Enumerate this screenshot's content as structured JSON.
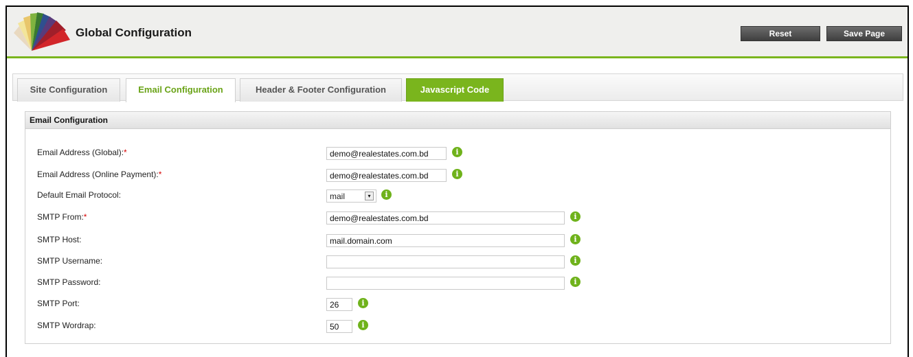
{
  "header": {
    "title": "Global Configuration",
    "reset_label": "Reset",
    "save_label": "Save Page",
    "accent_color": "#7ab51d"
  },
  "tabs": [
    {
      "label": "Site Configuration",
      "state": "normal"
    },
    {
      "label": "Email Configuration",
      "state": "active"
    },
    {
      "label": "Header & Footer Configuration",
      "state": "normal"
    },
    {
      "label": "Javascript Code",
      "state": "highlighted"
    }
  ],
  "panel": {
    "title": "Email Configuration",
    "fields": [
      {
        "label": "Email Address (Global):",
        "required": true,
        "value": "demo@realestates.com.bd",
        "type": "text"
      },
      {
        "label": "Email Address (Online Payment):",
        "required": true,
        "value": "demo@realestates.com.bd",
        "type": "text"
      },
      {
        "label": "Default Email Protocol:",
        "required": false,
        "value": "mail",
        "type": "select"
      },
      {
        "label": "SMTP From:",
        "required": true,
        "value": "demo@realestates.com.bd",
        "type": "text"
      },
      {
        "label": "SMTP Host:",
        "required": false,
        "value": "mail.domain.com",
        "type": "text"
      },
      {
        "label": "SMTP Username:",
        "required": false,
        "value": "",
        "type": "text"
      },
      {
        "label": "SMTP Password:",
        "required": false,
        "value": "",
        "type": "password"
      },
      {
        "label": "SMTP Port:",
        "required": false,
        "value": "26",
        "type": "text"
      },
      {
        "label": "SMTP Wordrap:",
        "required": false,
        "value": "50",
        "type": "text"
      }
    ],
    "required_mark": "*",
    "info_icon": "info-icon",
    "info_glyph": "i",
    "select_arrow": "▾"
  }
}
